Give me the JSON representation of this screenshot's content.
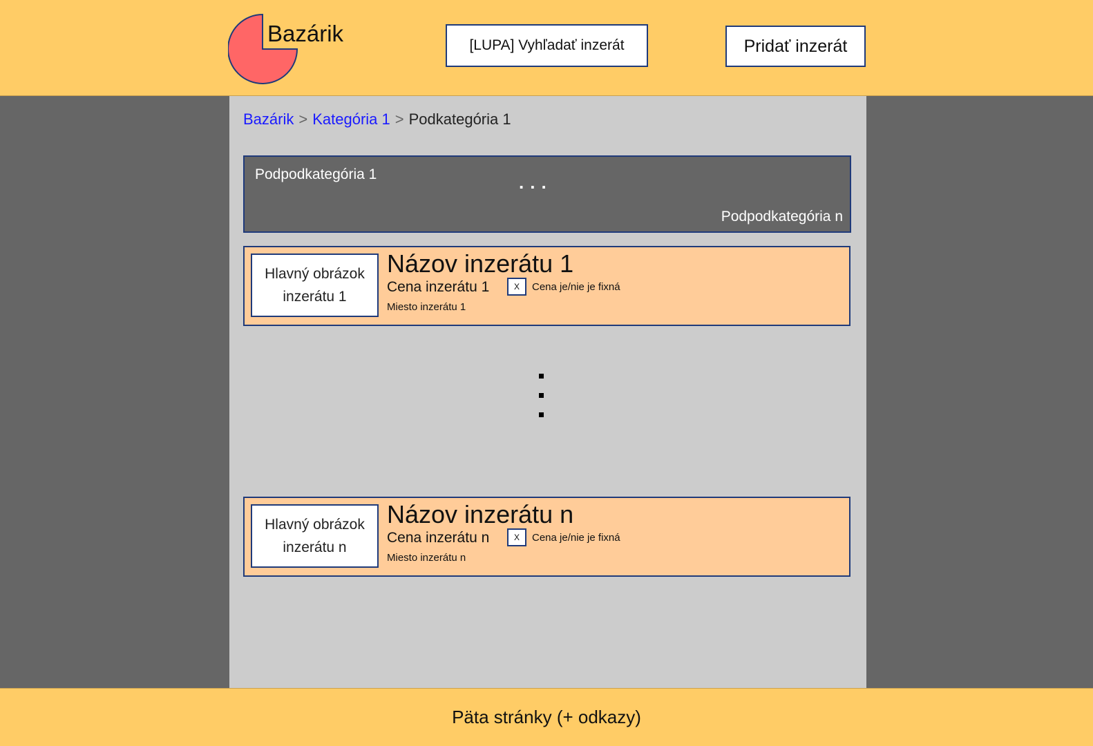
{
  "header": {
    "logo_text": "Bazárik",
    "search_label": "[LUPA] Vyhľadať inzerát",
    "add_label": "Pridať inzerát"
  },
  "breadcrumb": {
    "items": [
      "Bazárik",
      "Kategória 1",
      "Podkategória 1"
    ],
    "separator": ">"
  },
  "subcategories": {
    "first": "Podpodkategória 1",
    "ellipsis": "...",
    "last": "Podpodkategória n"
  },
  "listings": [
    {
      "image_label": "Hlavný obrázok inzerátu 1",
      "title": "Názov inzerátu 1",
      "price": "Cena inzerátu 1",
      "fixed_mark": "X",
      "fixed_label": "Cena je/nie je fixná",
      "place": "Miesto inzerátu 1"
    },
    {
      "image_label": "Hlavný obrázok inzerátu n",
      "title": "Názov inzerátu n",
      "price": "Cena inzerátu n",
      "fixed_mark": "X",
      "fixed_label": "Cena je/nie je fixná",
      "place": "Miesto inzerátu n"
    }
  ],
  "footer": {
    "text": "Päta stránky (+ odkazy)"
  },
  "colors": {
    "header_bg": "#ffcc66",
    "side_bg": "#666666",
    "content_bg": "#cccccc",
    "listing_bg": "#ffcc99",
    "logo_fill": "#ff6666",
    "border": "#1f3a7a",
    "link": "#1a1aff"
  }
}
